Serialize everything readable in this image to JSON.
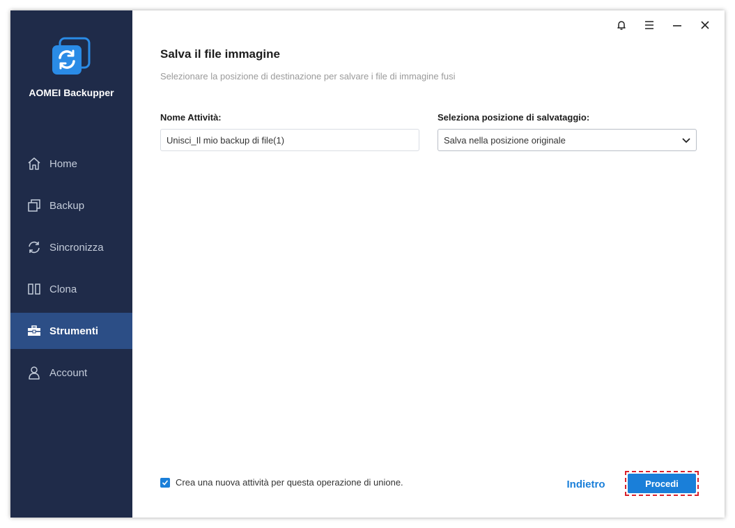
{
  "app": {
    "name": "AOMEI Backupper"
  },
  "sidebar": {
    "items": [
      {
        "label": "Home",
        "icon": "home-icon"
      },
      {
        "label": "Backup",
        "icon": "backup-icon"
      },
      {
        "label": "Sincronizza",
        "icon": "sync-icon"
      },
      {
        "label": "Clona",
        "icon": "clone-icon"
      },
      {
        "label": "Strumenti",
        "icon": "toolbox-icon",
        "active": true
      },
      {
        "label": "Account",
        "icon": "user-icon"
      }
    ]
  },
  "titlebar": {
    "icons": [
      "bell-icon",
      "menu-icon",
      "minimize-icon",
      "close-icon"
    ]
  },
  "page": {
    "title": "Salva il file immagine",
    "subtitle": "Selezionare la posizione di destinazione per salvare i file di immagine fusi"
  },
  "form": {
    "task_name_label": "Nome Attività:",
    "task_name_value": "Unisci_Il mio backup di file(1)",
    "location_label": "Seleziona posizione di salvataggio:",
    "location_value": "Salva nella posizione originale"
  },
  "footer": {
    "checkbox_label": "Crea una nuova attività per questa operazione di unione.",
    "checkbox_checked": true,
    "back_label": "Indietro",
    "proceed_label": "Procedi"
  },
  "colors": {
    "sidebar_bg": "#1f2b49",
    "sidebar_active": "#2c4e86",
    "accent": "#1a7fd9",
    "highlight_border": "#d8212c"
  }
}
